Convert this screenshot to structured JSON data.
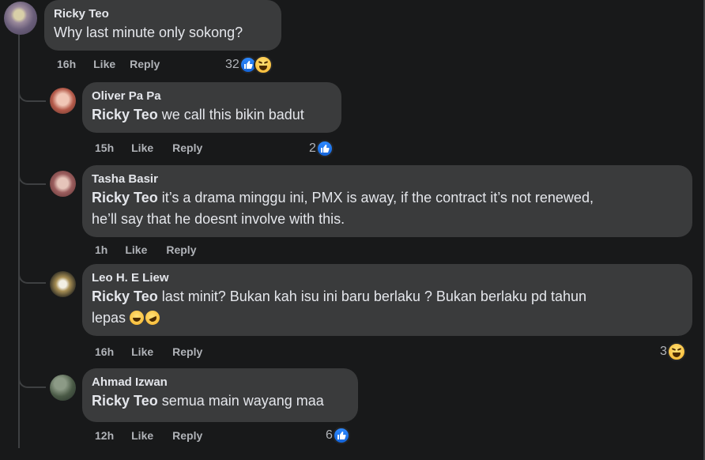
{
  "comments": [
    {
      "author": "Ricky Teo",
      "text": "Why last minute only sokong?",
      "time": "16h",
      "like_label": "Like",
      "reply_label": "Reply",
      "reaction_count": "32",
      "reactions": [
        "like-icon",
        "haha-icon"
      ]
    },
    {
      "author": "Oliver Pa Pa",
      "mention": "Ricky Teo",
      "text": " we call this bikin badut",
      "time": "15h",
      "like_label": "Like",
      "reply_label": "Reply",
      "reaction_count": "2",
      "reactions": [
        "like-icon"
      ]
    },
    {
      "author": "Tasha Basir",
      "mention": "Ricky Teo",
      "text_line1": " it’s a drama minggu ini, PMX is away, if the contract it’s not renewed,",
      "text_line2": "he’ll say that he doesnt involve with this.",
      "time": "1h",
      "like_label": "Like",
      "reply_label": "Reply"
    },
    {
      "author": "Leo H. E Liew",
      "mention": "Ricky Teo",
      "text_line1": " last minit? Bukan kah isu ini baru berlaku ? Bukan berlaku pd tahun",
      "text_line2": "lepas",
      "inline_emojis": [
        "grinning-sweat-emoji",
        "rofl-emoji"
      ],
      "time": "16h",
      "like_label": "Like",
      "reply_label": "Reply",
      "reaction_count": "3",
      "reactions": [
        "haha-icon"
      ]
    },
    {
      "author": "Ahmad Izwan",
      "mention": "Ricky Teo",
      "text": " semua main wayang maa",
      "time": "12h",
      "like_label": "Like",
      "reply_label": "Reply",
      "reaction_count": "6",
      "reactions": [
        "like-icon"
      ]
    }
  ],
  "colors": {
    "background": "#18191a",
    "bubble": "#3a3b3c",
    "text": "#e4e6eb",
    "meta": "#b0b3b8",
    "like_blue": "#1877f2",
    "haha_yellow": "#f7b125"
  }
}
